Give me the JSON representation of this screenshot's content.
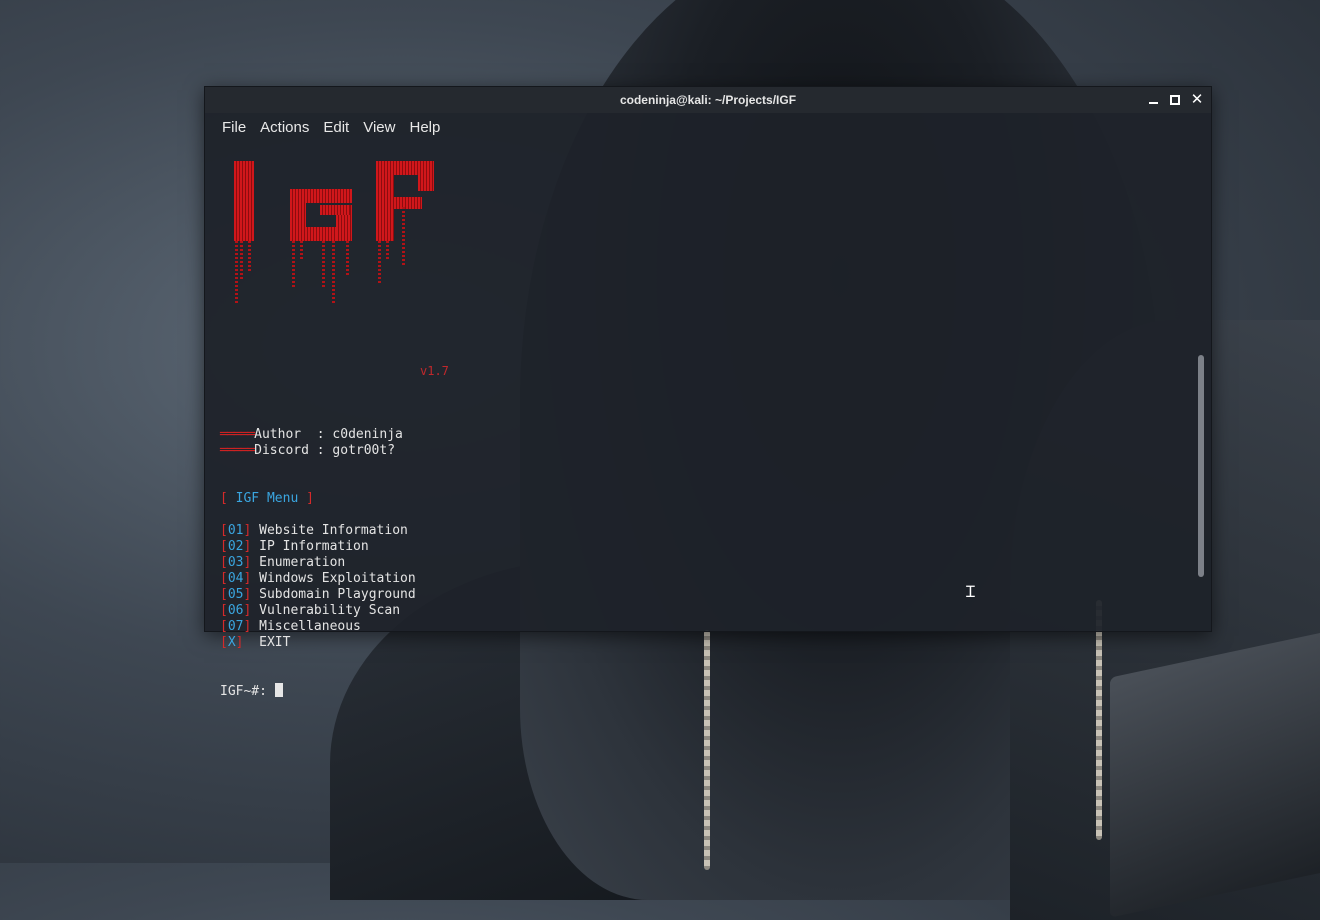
{
  "window": {
    "title": "codeninja@kali: ~/Projects/IGF"
  },
  "menu": [
    "File",
    "Actions",
    "Edit",
    "View",
    "Help"
  ],
  "logo": {
    "text": "IGF",
    "version": "v1.7"
  },
  "info": {
    "author_label": "Author  : ",
    "author_value": "c0deninja",
    "discord_label": "Discord : ",
    "discord_value": "gotr00t?"
  },
  "menu_title": {
    "open": "[ ",
    "label": "IGF Menu",
    "close": " ]"
  },
  "options": [
    {
      "key": "01",
      "label": "Website Information"
    },
    {
      "key": "02",
      "label": "IP Information"
    },
    {
      "key": "03",
      "label": "Enumeration"
    },
    {
      "key": "04",
      "label": "Windows Exploitation"
    },
    {
      "key": "05",
      "label": "Subdomain Playground"
    },
    {
      "key": "06",
      "label": "Vulnerability Scan"
    },
    {
      "key": "07",
      "label": "Miscellaneous"
    },
    {
      "key": "X",
      "label": "EXIT"
    }
  ],
  "prompt": "IGF~#: ",
  "colors": {
    "accent_red": "#d42a2a",
    "accent_blue": "#3aa6e0",
    "terminal_bg": "#1e2229"
  }
}
